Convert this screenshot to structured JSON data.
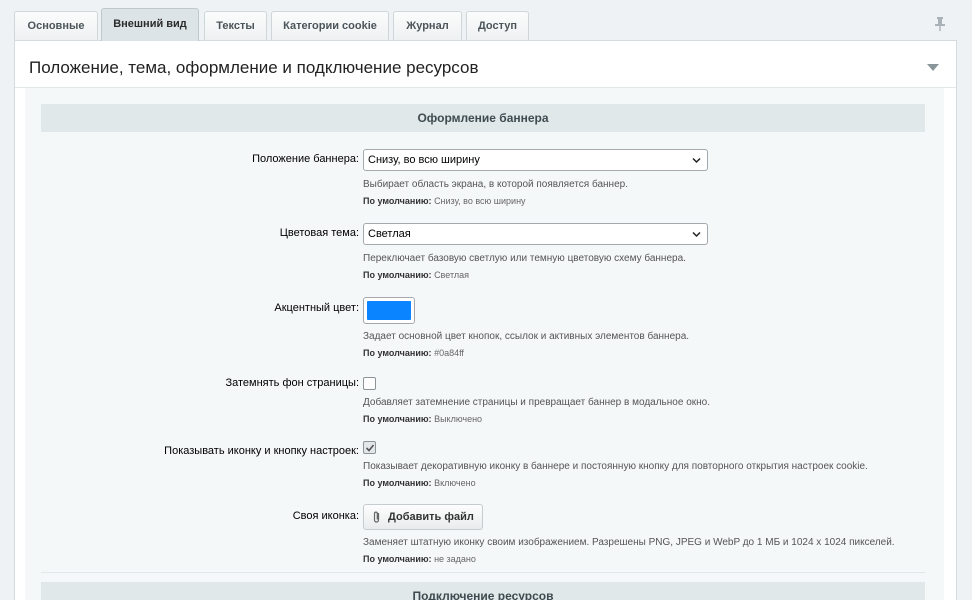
{
  "tabs": [
    {
      "label": "Основные",
      "active": false
    },
    {
      "label": "Внешний вид",
      "active": true
    },
    {
      "label": "Тексты",
      "active": false
    },
    {
      "label": "Категории cookie",
      "active": false
    },
    {
      "label": "Журнал",
      "active": false
    },
    {
      "label": "Доступ",
      "active": false
    }
  ],
  "panel": {
    "title": "Положение, тема, оформление и подключение ресурсов"
  },
  "sections": {
    "banner": "Оформление баннера",
    "resources": "Подключение ресурсов"
  },
  "fields": {
    "position": {
      "label": "Положение баннера:",
      "value": "Снизу, во всю ширину",
      "hint": "Выбирает область экрана, в которой появляется баннер.",
      "default_label": "По умолчанию:",
      "default_value": "Снизу, во всю ширину"
    },
    "theme": {
      "label": "Цветовая тема:",
      "value": "Светлая",
      "hint": "Переключает базовую светлую или темную цветовую схему баннера.",
      "default_label": "По умолчанию:",
      "default_value": "Светлая"
    },
    "accent": {
      "label": "Акцентный цвет:",
      "color": "#0a84ff",
      "hint": "Задает основной цвет кнопок, ссылок и активных элементов баннера.",
      "default_label": "По умолчанию:",
      "default_value": "#0a84ff"
    },
    "overlay": {
      "label": "Затемнять фон страницы:",
      "checked": false,
      "hint": "Добавляет затемнение страницы и превращает баннер в модальное окно.",
      "default_label": "По умолчанию:",
      "default_value": "Выключено"
    },
    "show_icon": {
      "label": "Показывать иконку и кнопку настроек:",
      "checked": true,
      "hint": "Показывает декоративную иконку в баннере и постоянную кнопку для повторного открытия настроек cookie.",
      "default_label": "По умолчанию:",
      "default_value": "Включено"
    },
    "custom_icon": {
      "label": "Своя иконка:",
      "button": "Добавить файл",
      "hint": "Заменяет штатную иконку своим изображением. Разрешены PNG, JPEG и WebP до 1 МБ и 1024 x 1024 пикселей.",
      "default_label": "По умолчанию:",
      "default_value": "не задано"
    }
  },
  "icons": {
    "pin": "pin-icon",
    "collapse": "triangle-down-icon",
    "select_arrow": "chevron-down-icon",
    "check": "check-icon",
    "clip": "paperclip-icon"
  }
}
